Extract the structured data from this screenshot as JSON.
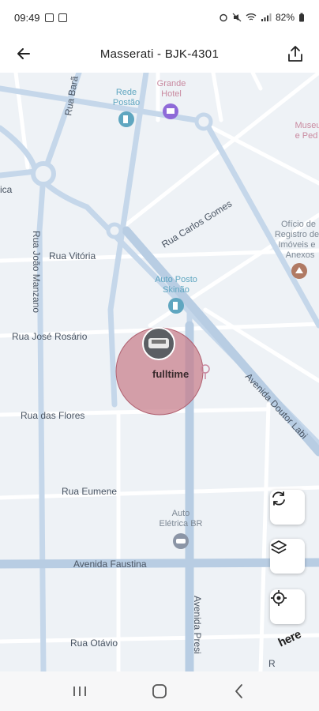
{
  "status_bar": {
    "time": "09:49",
    "battery": "82%"
  },
  "header": {
    "title": "Masserati - BJK-4301",
    "back_icon": "arrow-left-icon",
    "share_icon": "share-upload-icon"
  },
  "map": {
    "streets": {
      "rua_barao": "Rua Barã",
      "rua_carlos_gomes": "Rua Carlos Gomes",
      "rua_vitoria": "Rua Vitória",
      "rua_joao_manzano": "Rua João Manzano",
      "rua_jose_rosario": "Rua José Rosário",
      "avenida_doutor": "Avenida Doutor Labi",
      "rua_das_flores": "Rua das Flores",
      "rua_eumene": "Rua Eumene",
      "avenida_faustina": "Avenida Faustina",
      "avenida_presi": "Avenida Presi",
      "rua_otavio": "Rua Otávio",
      "edge_ica": "ica",
      "edge_r": "R"
    },
    "pois": {
      "rede_postao": [
        "Rede",
        "Postão"
      ],
      "grande_hotel": [
        "Grande",
        "Hotel"
      ],
      "museu": [
        "Museu",
        "e Ped"
      ],
      "oficio": [
        "Ofício de",
        "Registro de",
        "Imóveis e",
        "Anexos"
      ],
      "auto_posto": [
        "Auto Posto",
        "Skinão"
      ],
      "auto_eletrica": [
        "Auto",
        "Elétrica BR"
      ]
    },
    "vehicle_marker": {
      "label": "fulltime",
      "icon": "car-avatar-icon"
    },
    "controls": {
      "refresh_icon": "refresh-icon",
      "layers_icon": "layers-icon",
      "locate_icon": "locate-icon"
    },
    "attribution": "here"
  },
  "nav_bar": {
    "recent_icon": "recent-apps-icon",
    "home_icon": "home-icon",
    "back_icon": "back-chevron-icon"
  },
  "colors": {
    "road_major": "#c5d7ea",
    "road_minor": "#ffffff",
    "map_bg": "#eef2f6",
    "accuracy_circle": "#c77b88",
    "poi_blue": "#5fa6c0",
    "poi_purple": "#8e6ad8"
  }
}
